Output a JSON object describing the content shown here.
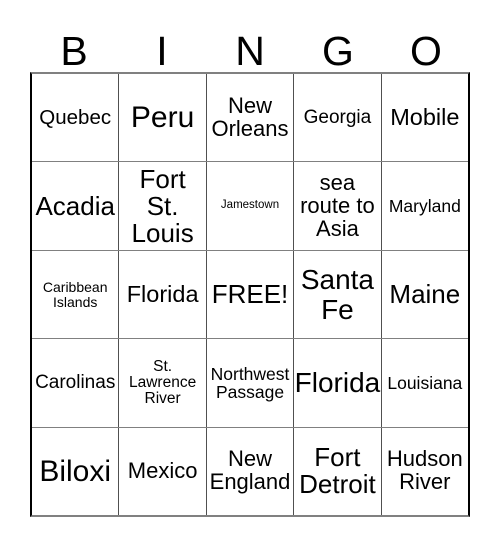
{
  "card": {
    "title": "BINGO",
    "header_letters": [
      "B",
      "I",
      "N",
      "G",
      "O"
    ],
    "free_space_label": "FREE!",
    "colors": {
      "text": "#000000",
      "background": "#ffffff",
      "outer_border": "#000000",
      "inner_grid_line": "#808080"
    },
    "rows": [
      [
        {
          "label": "Quebec",
          "size": "fs-20"
        },
        {
          "label": "Peru",
          "size": "fs-30"
        },
        {
          "label": "New Orleans",
          "size": "fs-22"
        },
        {
          "label": "Georgia",
          "size": "fs-19"
        },
        {
          "label": "Mobile",
          "size": "fs-23"
        }
      ],
      [
        {
          "label": "Acadia",
          "size": "fs-26"
        },
        {
          "label": "Fort St. Louis",
          "size": "fs-26"
        },
        {
          "label": "Jamestown",
          "size": "fs-11"
        },
        {
          "label": "sea route to Asia",
          "size": "fs-22"
        },
        {
          "label": "Maryland",
          "size": "fs-17"
        }
      ],
      [
        {
          "label": "Caribbean Islands",
          "size": "fs-14"
        },
        {
          "label": "Florida",
          "size": "fs-23"
        },
        {
          "label": "FREE!",
          "size": "fs-26"
        },
        {
          "label": "Santa Fe",
          "size": "fs-28"
        },
        {
          "label": "Maine",
          "size": "fs-26"
        }
      ],
      [
        {
          "label": "Carolinas",
          "size": "fs-19"
        },
        {
          "label": "St. Lawrence River",
          "size": "fs-15"
        },
        {
          "label": "Northwest Passage",
          "size": "fs-17"
        },
        {
          "label": "Florida",
          "size": "fs-28"
        },
        {
          "label": "Louisiana",
          "size": "fs-17"
        }
      ],
      [
        {
          "label": "Biloxi",
          "size": "fs-30"
        },
        {
          "label": "Mexico",
          "size": "fs-22"
        },
        {
          "label": "New England",
          "size": "fs-22"
        },
        {
          "label": "Fort Detroit",
          "size": "fs-26"
        },
        {
          "label": "Hudson River",
          "size": "fs-22"
        }
      ]
    ]
  }
}
